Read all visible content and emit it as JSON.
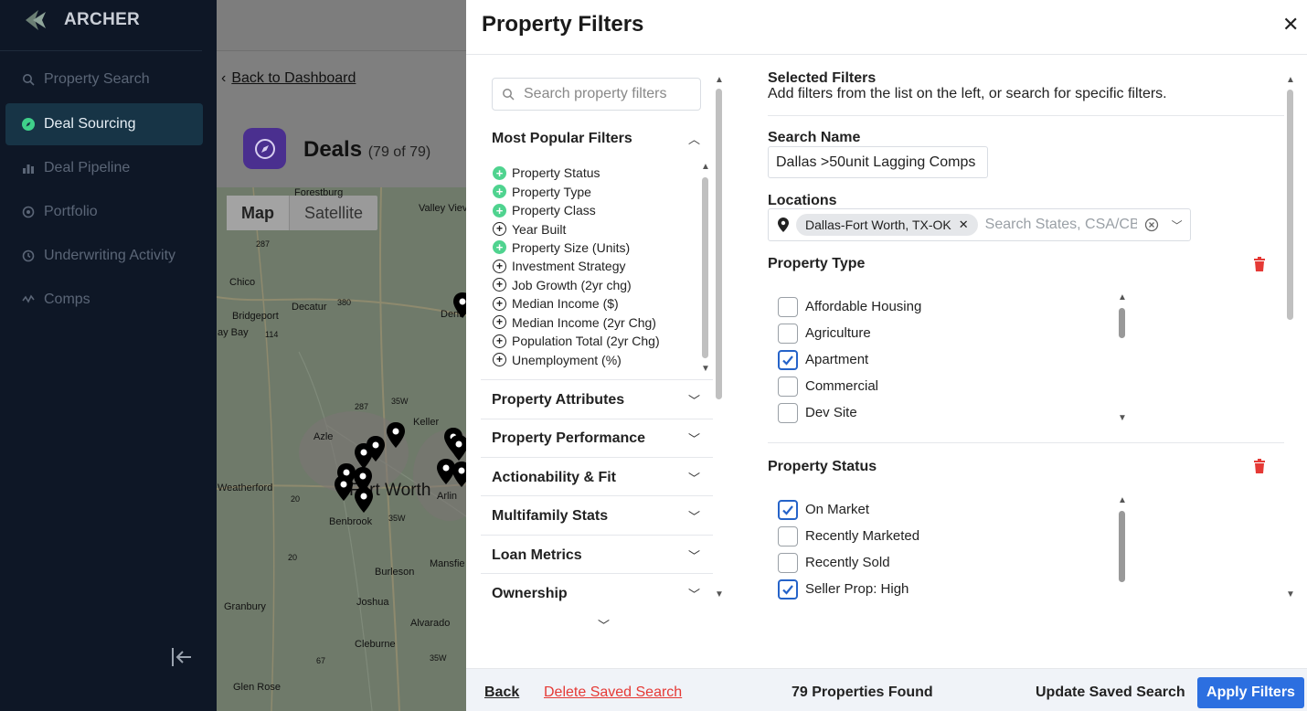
{
  "app": {
    "name": "ARCHER"
  },
  "sidebar": {
    "items": [
      {
        "label": "Property Search",
        "icon": "search-icon"
      },
      {
        "label": "Deal Sourcing",
        "icon": "compass-icon"
      },
      {
        "label": "Deal Pipeline",
        "icon": "bar-chart-icon"
      },
      {
        "label": "Portfolio",
        "icon": "target-icon"
      },
      {
        "label": "Underwriting Activity",
        "icon": "history-icon"
      },
      {
        "label": "Comps",
        "icon": "activity-icon"
      }
    ],
    "active": "Deal Sourcing"
  },
  "background": {
    "back_link": "Back to Dashboard",
    "deals_title": "Deals",
    "deals_count": "(79 of 79)",
    "map_tabs": [
      "Map",
      "Satellite"
    ],
    "map_labels": [
      "Forestburg",
      "Valley Viev",
      "287",
      "Chico",
      "Decatur",
      "380",
      "Dent",
      "Bridgeport",
      "ay Bay",
      "114",
      "287",
      "35W",
      "Keller",
      "Azle",
      "Weatherford",
      "Fort Worth",
      "Arlin",
      "Benbrook",
      "35W",
      "20",
      "Burleson",
      "Mansfie",
      "Granbury",
      "Joshua",
      "Alvarado",
      "Cleburne",
      "67",
      "35W",
      "Glen Rose",
      "20"
    ]
  },
  "panel": {
    "title": "Property Filters",
    "search_placeholder": "Search property filters",
    "most_popular": {
      "title": "Most Popular Filters",
      "items": [
        {
          "label": "Property Status",
          "added": true
        },
        {
          "label": "Property Type",
          "added": true
        },
        {
          "label": "Property Class",
          "added": true
        },
        {
          "label": "Year Built",
          "added": false
        },
        {
          "label": "Property Size (Units)",
          "added": true
        },
        {
          "label": "Investment Strategy",
          "added": false
        },
        {
          "label": "Job Growth (2yr chg)",
          "added": false
        },
        {
          "label": "Median Income ($)",
          "added": false
        },
        {
          "label": "Median Income (2yr Chg)",
          "added": false
        },
        {
          "label": "Population Total (2yr Chg)",
          "added": false
        },
        {
          "label": "Unemployment (%)",
          "added": false
        }
      ]
    },
    "sections": [
      "Property Attributes",
      "Property Performance",
      "Actionability & Fit",
      "Multifamily Stats",
      "Loan Metrics",
      "Ownership"
    ],
    "selected": {
      "title": "Selected Filters",
      "subtitle": "Add filters from the list on the left, or search for specific filters.",
      "search_name_label": "Search Name",
      "search_name_value": "Dallas >50unit Lagging Comps",
      "locations_label": "Locations",
      "location_chip": "Dallas-Fort Worth, TX-OK",
      "locations_placeholder": "Search States, CSA/CBSA",
      "property_type": {
        "label": "Property Type",
        "options": [
          {
            "label": "Affordable Housing",
            "checked": false
          },
          {
            "label": "Agriculture",
            "checked": false
          },
          {
            "label": "Apartment",
            "checked": true
          },
          {
            "label": "Commercial",
            "checked": false
          },
          {
            "label": "Dev Site",
            "checked": false
          }
        ]
      },
      "property_status": {
        "label": "Property Status",
        "options": [
          {
            "label": "On Market",
            "checked": true
          },
          {
            "label": "Recently Marketed",
            "checked": false
          },
          {
            "label": "Recently Sold",
            "checked": false
          },
          {
            "label": "Seller Prop: High",
            "checked": true
          }
        ]
      }
    },
    "footer": {
      "back": "Back",
      "delete": "Delete Saved Search",
      "found": "79 Properties Found",
      "update": "Update Saved Search",
      "apply": "Apply Filters"
    },
    "colors": {
      "accent": "#2c6fe0",
      "danger": "#e53935",
      "added": "#4fd38f"
    }
  }
}
